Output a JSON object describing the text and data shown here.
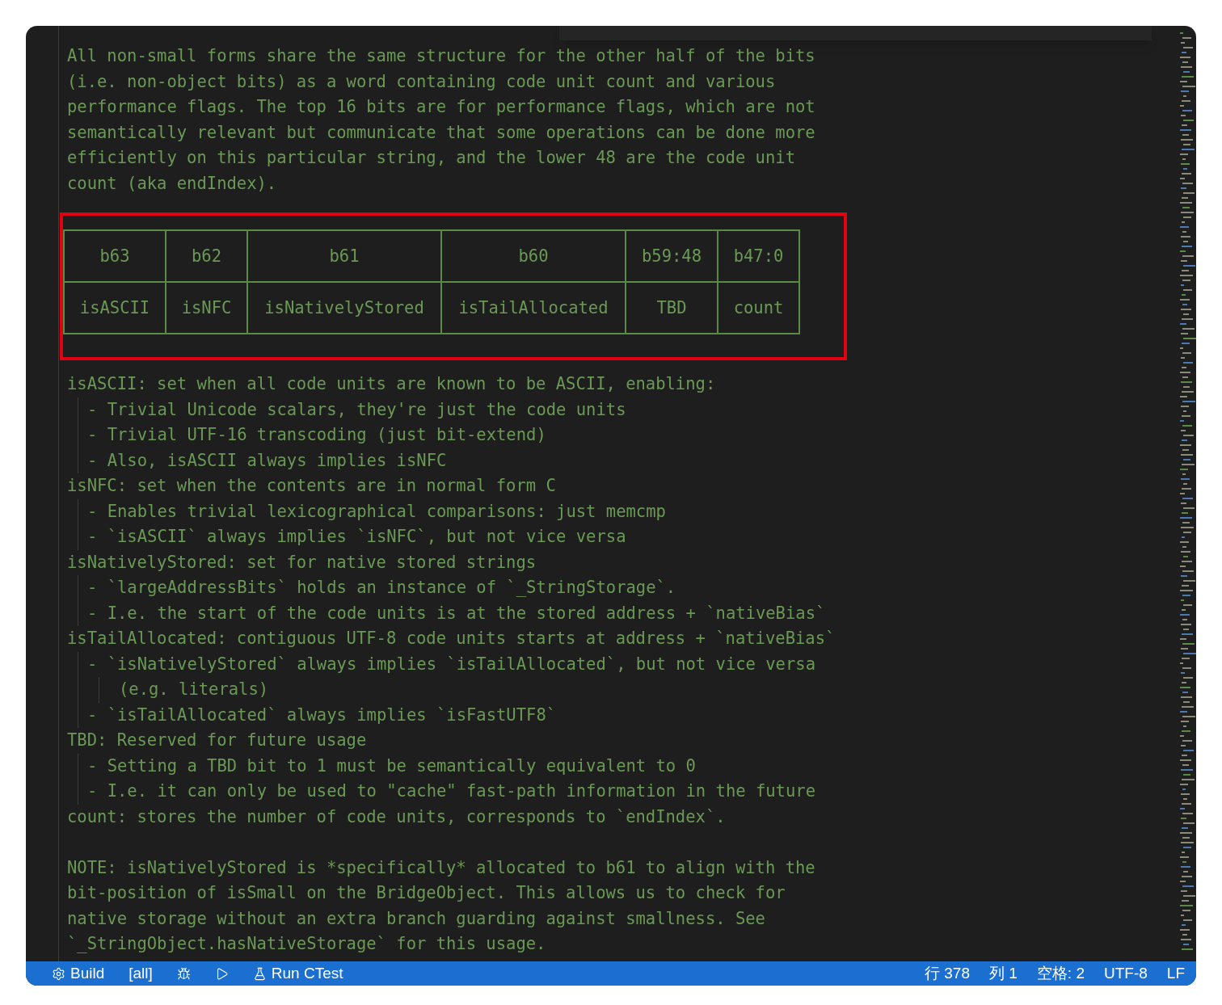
{
  "editor": {
    "intro": [
      "All non-small forms share the same structure for the other half of the bits",
      "(i.e. non-object bits) as a word containing code unit count and various",
      "performance flags. The top 16 bits are for performance flags, which are not",
      "semantically relevant but communicate that some operations can be done more",
      "efficiently on this particular string, and the lower 48 are the code unit",
      "count (aka endIndex)."
    ],
    "table": {
      "columns": [
        "b63",
        "b62",
        "b61",
        "b60",
        "b59:48",
        "b47:0"
      ],
      "rows": [
        [
          "isASCII",
          "isNFC",
          "isNativelyStored",
          "isTailAllocated",
          "TBD",
          "count"
        ]
      ]
    },
    "outline": [
      {
        "text": "isASCII: set when all code units are known to be ASCII, enabling:",
        "children": [
          {
            "text": "- Trivial Unicode scalars, they're just the code units"
          },
          {
            "text": "- Trivial UTF-16 transcoding (just bit-extend)"
          },
          {
            "text": "- Also, isASCII always implies isNFC"
          }
        ]
      },
      {
        "text": "isNFC: set when the contents are in normal form C",
        "children": [
          {
            "text": "- Enables trivial lexicographical comparisons: just memcmp"
          },
          {
            "text": "- `isASCII` always implies `isNFC`, but not vice versa"
          }
        ]
      },
      {
        "text": "isNativelyStored: set for native stored strings",
        "children": [
          {
            "text": "- `largeAddressBits` holds an instance of `_StringStorage`."
          },
          {
            "text": "- I.e. the start of the code units is at the stored address + `nativeBias`"
          }
        ]
      },
      {
        "text": "isTailAllocated: contiguous UTF-8 code units starts at address + `nativeBias`",
        "children": [
          {
            "text": "- `isNativelyStored` always implies `isTailAllocated`, but not vice versa",
            "children": [
              {
                "text": "(e.g. literals)"
              }
            ]
          },
          {
            "text": "- `isTailAllocated` always implies `isFastUTF8`"
          }
        ]
      },
      {
        "text": "TBD: Reserved for future usage",
        "children": [
          {
            "text": "- Setting a TBD bit to 1 must be semantically equivalent to 0"
          },
          {
            "text": "- I.e. it can only be used to \"cache\" fast-path information in the future"
          }
        ]
      },
      {
        "text": "count: stores the number of code units, corresponds to `endIndex`."
      }
    ],
    "note": [
      "NOTE: isNativelyStored is *specifically* allocated to b61 to align with the",
      "bit-position of isSmall on the BridgeObject. This allows us to check for",
      "native storage without an extra branch guarding against smallness. See",
      "`_StringObject.hasNativeStorage` for this usage."
    ]
  },
  "status_bar": {
    "left": [
      {
        "kind": "gear",
        "label": "Build"
      },
      {
        "kind": "text",
        "label": "[all]"
      },
      {
        "kind": "bug"
      },
      {
        "kind": "play"
      },
      {
        "kind": "flask",
        "label": "Run CTest"
      }
    ],
    "right": [
      "行 378",
      "列 1",
      "空格: 2",
      "UTF-8",
      "LF"
    ]
  }
}
